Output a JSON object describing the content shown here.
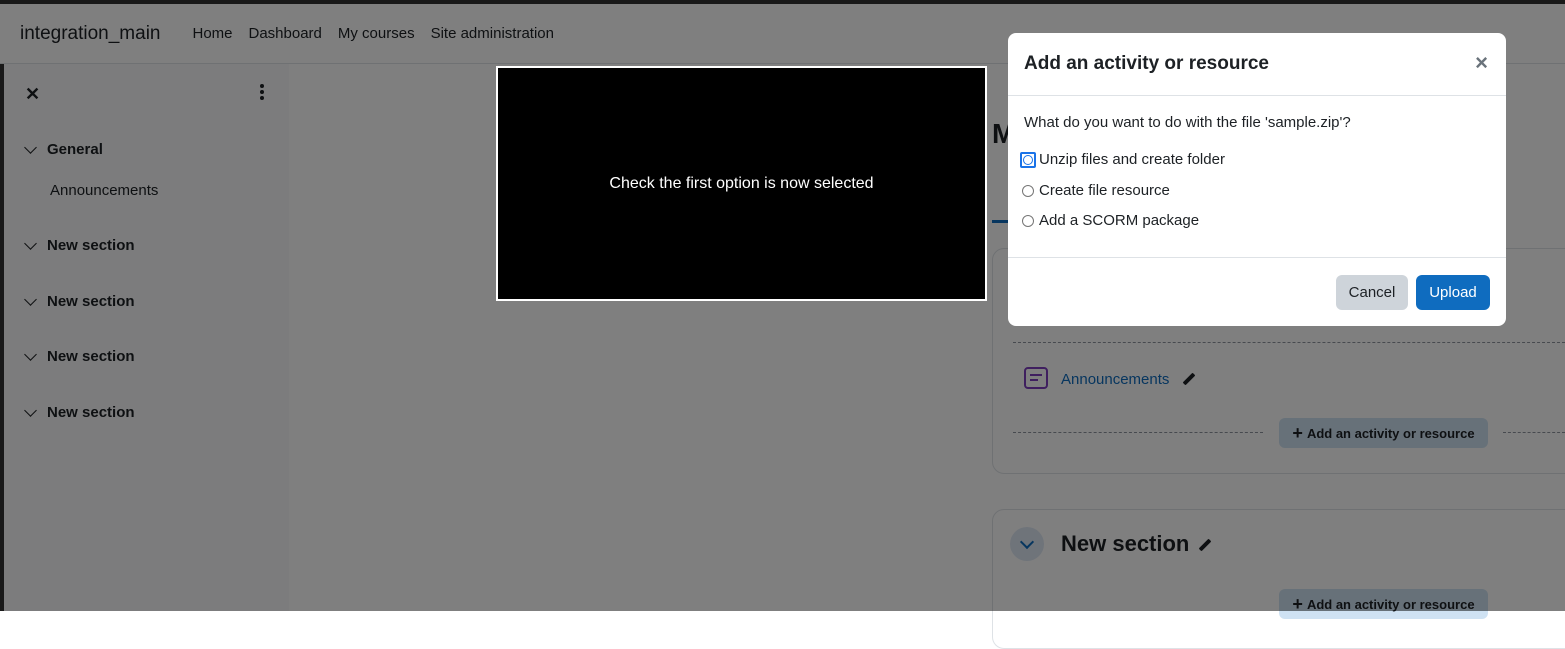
{
  "topbar": {
    "site_name": "integration_main",
    "nav": [
      "Home",
      "Dashboard",
      "My courses",
      "Site administration"
    ]
  },
  "drawer": {
    "close_icon": "close-icon",
    "menu_icon": "kebab-menu-icon",
    "sections": [
      {
        "label": "General",
        "items": [
          "Announcements"
        ]
      },
      {
        "label": "New section"
      },
      {
        "label": "New section"
      },
      {
        "label": "New section"
      },
      {
        "label": "New section"
      }
    ]
  },
  "main": {
    "title_fragment": "M",
    "activity": {
      "label": "Announcements",
      "icon": "forum-icon"
    },
    "add_activity_label": "Add an activity or resource",
    "section_heading": "New section"
  },
  "overlay": {
    "text": "Check the first option is now selected"
  },
  "modal": {
    "title": "Add an activity or resource",
    "close_label": "×",
    "question": "What do you want to do with the file 'sample.zip'?",
    "options": [
      "Unzip files and create folder",
      "Create file resource",
      "Add a SCORM package"
    ],
    "cancel_label": "Cancel",
    "upload_label": "Upload"
  },
  "colors": {
    "accent": "#0f6cbf",
    "backdrop": "rgba(0,0,0,0.5)"
  }
}
